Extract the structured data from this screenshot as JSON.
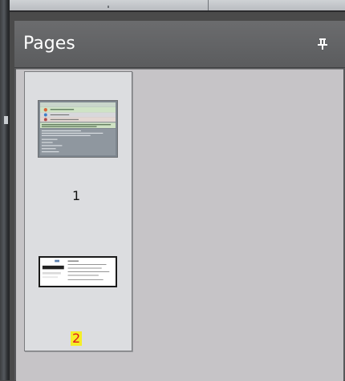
{
  "panel": {
    "title": "Pages",
    "pin_icon": "pin-icon"
  },
  "pages": [
    {
      "number": "1",
      "selected": false
    },
    {
      "number": "2",
      "selected": true
    }
  ],
  "colors": {
    "panel_header": "#5f6062",
    "panel_body": "#c6c4c7",
    "thumbnail_background": "#dcdde0",
    "selected_page_number_highlight": "#f5ee26",
    "selected_page_number_text": "#e0161c"
  }
}
